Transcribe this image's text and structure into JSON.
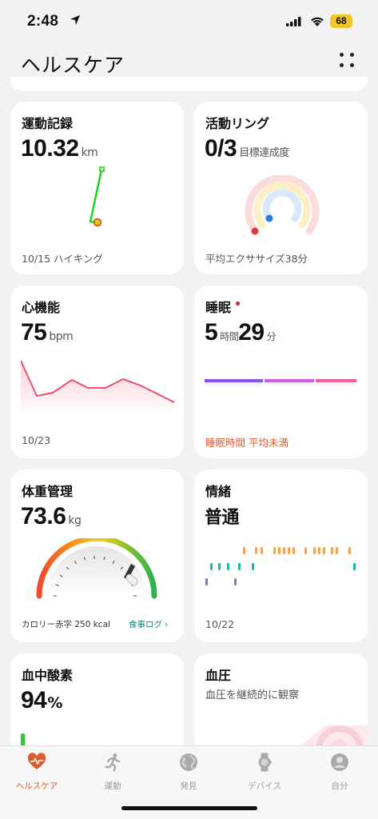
{
  "status": {
    "time": "2:48",
    "battery": "68"
  },
  "header": {
    "title": "ヘルスケア"
  },
  "cards": {
    "exercise": {
      "title": "運動記録",
      "value": "10.32",
      "unit": "km",
      "footer": "10/15 ハイキング"
    },
    "activity": {
      "title": "活動リング",
      "value": "0/3",
      "unit": "目標達成度",
      "footer": "平均エクササイズ38分"
    },
    "heart": {
      "title": "心機能",
      "value": "75",
      "unit": "bpm",
      "footer": "10/23"
    },
    "sleep": {
      "title": "睡眠",
      "hours": "5",
      "hours_unit": "時間",
      "minutes": "29",
      "minutes_unit": "分",
      "footer": "睡眠時間 平均未満"
    },
    "weight": {
      "title": "体重管理",
      "value": "73.6",
      "unit": "kg",
      "footer": "カロリー赤字 250 kcal",
      "link": "食事ログ"
    },
    "mood": {
      "title": "情緒",
      "value": "普通",
      "footer": "10/22"
    },
    "spo2": {
      "title": "血中酸素",
      "value": "94",
      "unit": "%"
    },
    "bp": {
      "title": "血圧",
      "subtitle": "血圧を継続的に観察"
    }
  },
  "tabs": [
    {
      "label": "ヘルスケア",
      "active": true
    },
    {
      "label": "運動",
      "active": false
    },
    {
      "label": "発見",
      "active": false
    },
    {
      "label": "デバイス",
      "active": false
    },
    {
      "label": "自分",
      "active": false
    }
  ],
  "colors": {
    "accent": "#e05a2b",
    "heart": "#f0506e",
    "link": "#0a8f84",
    "route": "#22d11c"
  }
}
